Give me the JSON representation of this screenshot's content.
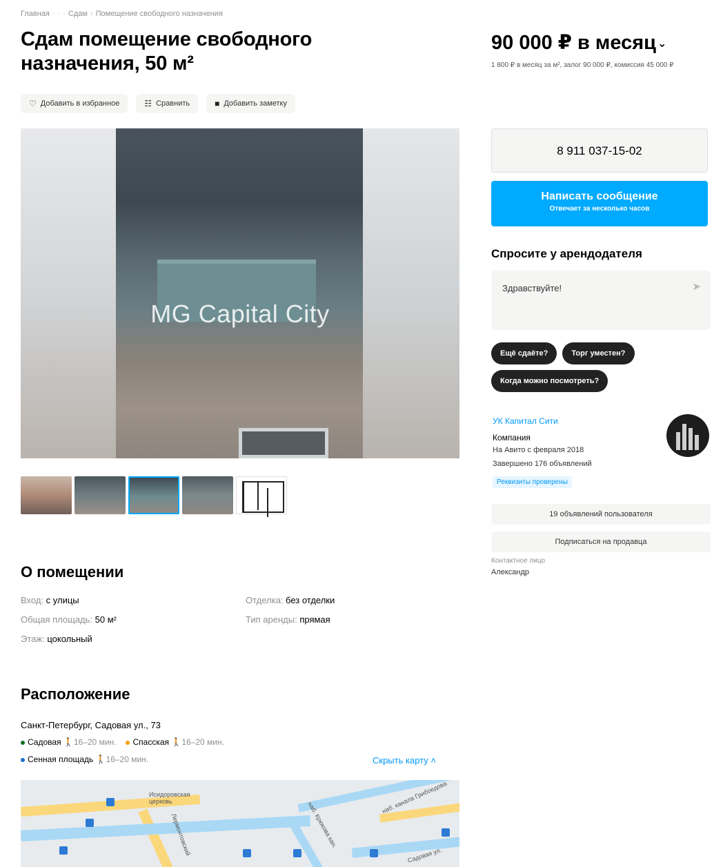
{
  "breadcrumb": {
    "items": [
      "Главная",
      "·",
      "·",
      "·",
      "Сдам",
      "Помещение свободного назначения"
    ]
  },
  "title": "Сдам помещение свободного назначения, 50 м²",
  "actions": {
    "favorite": "Добавить в избранное",
    "compare": "Сравнить",
    "note": "Добавить заметку"
  },
  "gallery": {
    "watermark": "MG Capital City",
    "selected_thumb": 3
  },
  "about": {
    "title": "О помещении",
    "params_left": [
      {
        "key": "Вход:",
        "value": "с улицы"
      },
      {
        "key": "Общая площадь:",
        "value": "50 м²"
      },
      {
        "key": "Этаж:",
        "value": "цокольный"
      }
    ],
    "params_right": [
      {
        "key": "Отделка:",
        "value": "без отделки"
      },
      {
        "key": "Тип аренды:",
        "value": "прямая"
      }
    ]
  },
  "location": {
    "title": "Расположение",
    "address": "Санкт-Петербург, Садовая ул., 73",
    "stations": [
      {
        "name": "Садовая",
        "time": "16–20 мин.",
        "color": "#0a6f20"
      },
      {
        "name": "Спасская",
        "time": "16–20 мин.",
        "color": "#f5a000"
      },
      {
        "name": "Сенная площадь",
        "time": "16–20 мин.",
        "color": "#1f6fd1"
      }
    ],
    "hide_map": "Скрыть карту",
    "map_labels": {
      "church": "Исидоровская церковь",
      "canal": "наб. канала Грибоедова",
      "street1": "наб. Крюкова кан.",
      "street2": "Лермонтовский",
      "street3": "Садовая ул."
    }
  },
  "price": {
    "main": "90 000 ₽ в месяц",
    "sub": "1 800 ₽ в месяц за м², залог 90 000 ₽, комиссия 45 000 ₽"
  },
  "contact": {
    "phone": "8 911 037-15-02",
    "message_title": "Написать сообщение",
    "message_sub": "Отвечает за несколько часов"
  },
  "ask": {
    "title": "Спросите у арендодателя",
    "input_value": "Здравствуйте!",
    "chips": [
      "Ещё сдаёте?",
      "Торг уместен?",
      "Когда можно посмотреть?"
    ]
  },
  "seller": {
    "name": "УК Капитал Сити",
    "type": "Компания",
    "since": "На Авито с февраля 2018",
    "done": "Завершено 176 объявлений",
    "badge": "Реквизиты проверены",
    "listings_btn": "19 объявлений пользователя",
    "subscribe_btn": "Подписаться на продавца",
    "contact_label": "Контактное лицо",
    "contact_name": "Александр"
  },
  "colors": {
    "accent": "#00aaff",
    "link": "#0099f7",
    "chip_bg": "#222222"
  }
}
